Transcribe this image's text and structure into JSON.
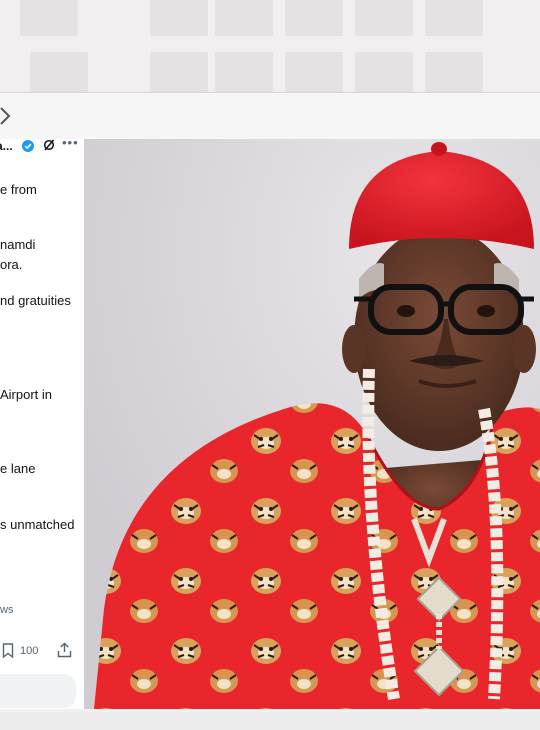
{
  "tweet": {
    "author_truncated": "a...",
    "lines": [
      "e from",
      "namdi",
      "ora.",
      "nd gratuities",
      "Airport in",
      "e lane",
      "s unmatched"
    ],
    "views_fragment": "ws",
    "bookmark_count": "100"
  },
  "colors": {
    "verified_badge": "#1d9bf0",
    "cap_red": "#e0242e",
    "attire_red": "#e8262b"
  },
  "icons": [
    "chevron-right-icon",
    "verified-badge-icon",
    "grok-icon",
    "more-icon",
    "bookmark-icon",
    "share-icon"
  ]
}
